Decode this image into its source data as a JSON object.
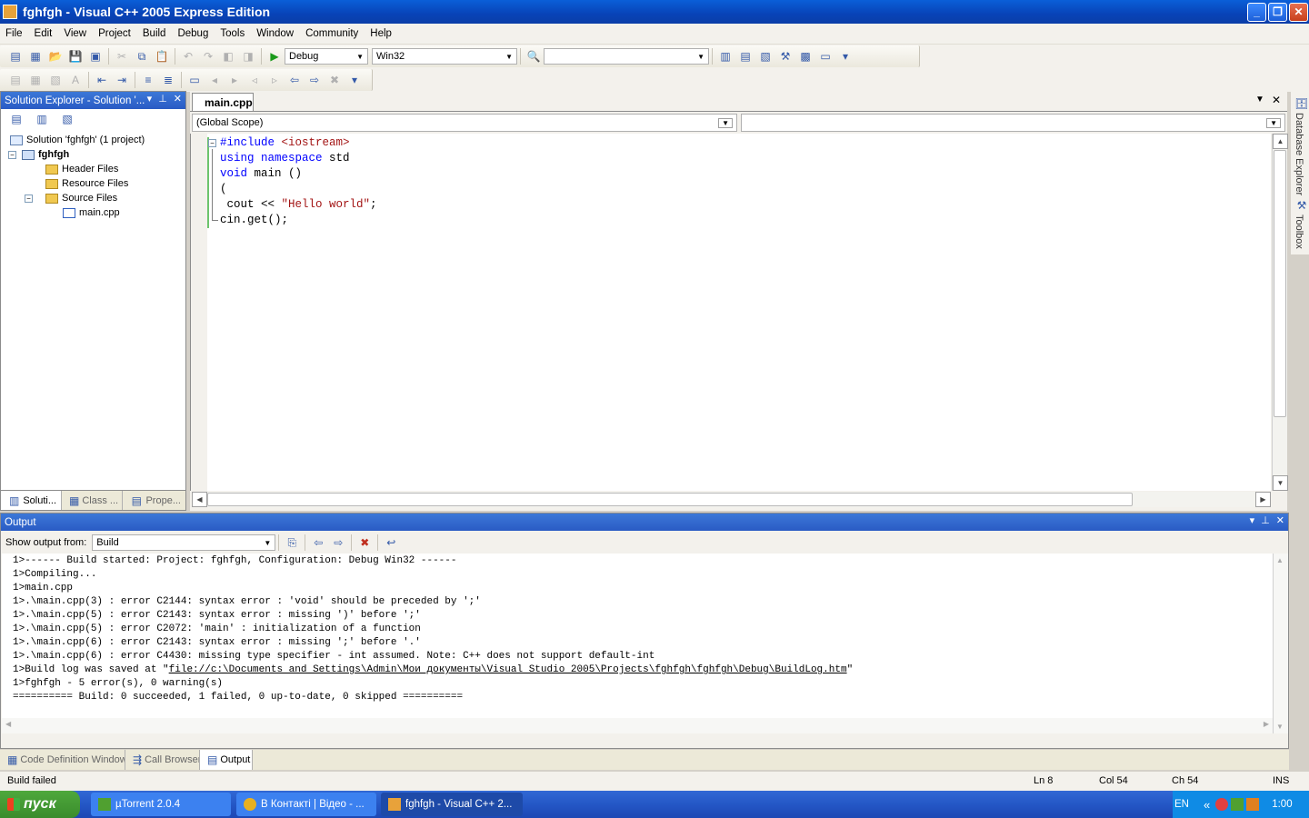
{
  "window": {
    "title": "fghfgh - Visual C++ 2005 Express Edition"
  },
  "menu": [
    "File",
    "Edit",
    "View",
    "Project",
    "Build",
    "Debug",
    "Tools",
    "Window",
    "Community",
    "Help"
  ],
  "toolbar": {
    "config": "Debug",
    "platform": "Win32",
    "find_value": ""
  },
  "solution_explorer": {
    "title": "Solution Explorer - Solution '...",
    "solution": "Solution 'fghfgh' (1 project)",
    "project": "fghfgh",
    "folders": [
      "Header Files",
      "Resource Files",
      "Source Files"
    ],
    "file": "main.cpp",
    "tabs": [
      "Soluti...",
      "Class ...",
      "Prope..."
    ]
  },
  "editor": {
    "tab": "main.cpp",
    "scope": "(Global Scope)",
    "member": "",
    "lines": [
      {
        "parts": [
          {
            "t": "#include ",
            "c": "kw"
          },
          {
            "t": "<iostream>",
            "c": "str"
          }
        ]
      },
      {
        "parts": [
          {
            "t": "using",
            "c": "kw"
          },
          {
            "t": " "
          },
          {
            "t": "namespace",
            "c": "kw"
          },
          {
            "t": " std"
          }
        ]
      },
      {
        "parts": [
          {
            "t": "void",
            "c": "kw"
          },
          {
            "t": " main ()"
          }
        ]
      },
      {
        "parts": [
          {
            "t": "("
          }
        ]
      },
      {
        "parts": [
          {
            "t": " cout << "
          },
          {
            "t": "\"Hello world\"",
            "c": "str"
          },
          {
            "t": ";"
          }
        ]
      },
      {
        "parts": [
          {
            "t": "cin.get();"
          }
        ]
      }
    ]
  },
  "right_tabs": [
    "Database Explorer",
    "Toolbox"
  ],
  "output": {
    "title": "Output",
    "show_from_label": "Show output from:",
    "show_from_value": "Build",
    "lines": [
      "1>------ Build started: Project: fghfgh, Configuration: Debug Win32 ------",
      "1>Compiling...",
      "1>main.cpp",
      "1>.\\main.cpp(3) : error C2144: syntax error : 'void' should be preceded by ';'",
      "1>.\\main.cpp(5) : error C2143: syntax error : missing ')' before ';'",
      "1>.\\main.cpp(5) : error C2072: 'main' : initialization of a function",
      "1>.\\main.cpp(6) : error C2143: syntax error : missing ';' before '.'",
      "1>.\\main.cpp(6) : error C4430: missing type specifier - int assumed. Note: C++ does not support default-int",
      "1>Build log was saved at \"file://c:\\Documents and Settings\\Admin\\Мои документы\\Visual Studio 2005\\Projects\\fghfgh\\fghfgh\\Debug\\BuildLog.htm\"",
      "1>fghfgh - 5 error(s), 0 warning(s)",
      "========== Build: 0 succeeded, 1 failed, 0 up-to-date, 0 skipped =========="
    ]
  },
  "bottom_tabs": [
    "Code Definition Window",
    "Call Browser",
    "Output"
  ],
  "status": {
    "message": "Build failed",
    "ln": "Ln 8",
    "col": "Col 54",
    "ch": "Ch 54",
    "mode": "INS"
  },
  "taskbar": {
    "start": "пуск",
    "tasks": [
      "µTorrent 2.0.4",
      "В Контакті | Відео - ...",
      "fghfgh - Visual C++ 2..."
    ],
    "lang": "EN",
    "clock": "1:00"
  }
}
